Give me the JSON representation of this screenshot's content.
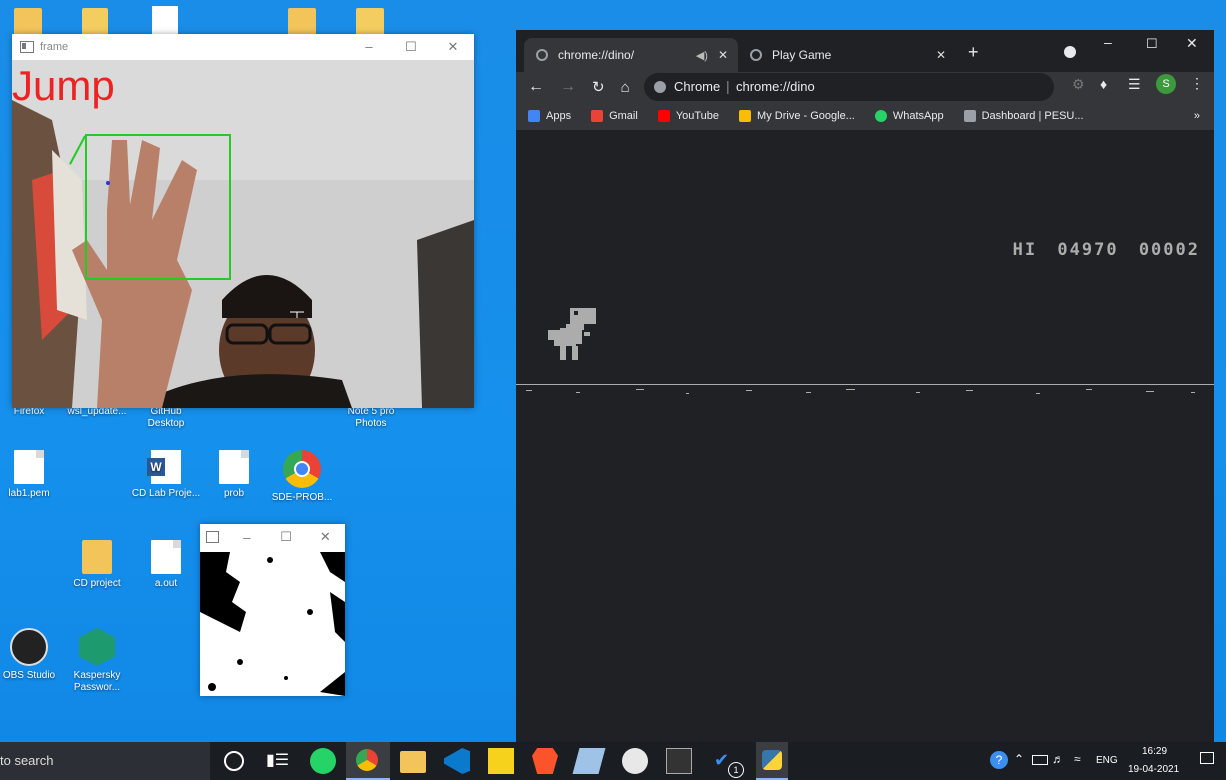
{
  "desktop": {
    "icons": [
      {
        "label": "Firefox",
        "name": "desktop-icon-firefox"
      },
      {
        "label": "wsl_update...",
        "name": "desktop-icon-wsl-update"
      },
      {
        "label": "GitHub Desktop",
        "name": "desktop-icon-github"
      },
      {
        "label": "Note 5 pro Photos",
        "name": "desktop-icon-note5"
      },
      {
        "label": "lab1.pem",
        "name": "desktop-icon-lab1"
      },
      {
        "label": "CD Lab Proje...",
        "name": "desktop-icon-cdlab"
      },
      {
        "label": "prob",
        "name": "desktop-icon-prob"
      },
      {
        "label": "SDE-PROB...",
        "name": "desktop-icon-sde"
      },
      {
        "label": "CD project",
        "name": "desktop-icon-cdproject"
      },
      {
        "label": "a.out",
        "name": "desktop-icon-aout"
      },
      {
        "label": "OBS Studio",
        "name": "desktop-icon-obs"
      },
      {
        "label": "Kaspersky Passwor...",
        "name": "desktop-icon-kaspersky"
      }
    ]
  },
  "frame_window": {
    "title": "frame",
    "overlay_text": "Jump",
    "box_color": "#22cc22",
    "text_color": "#ee2222"
  },
  "chrome": {
    "tabs": [
      {
        "label": "chrome://dino/"
      },
      {
        "label": "Play Game"
      }
    ],
    "omnibox_prefix": "Chrome",
    "omnibox_url": "chrome://dino",
    "bookmarks": [
      {
        "label": "Apps",
        "color": "#4285f4"
      },
      {
        "label": "Gmail",
        "color": "#ea4335"
      },
      {
        "label": "YouTube",
        "color": "#ff0000"
      },
      {
        "label": "My Drive - Google...",
        "color": "#fbbc04"
      },
      {
        "label": "WhatsApp",
        "color": "#25d366"
      },
      {
        "label": "Dashboard | PESU...",
        "color": "#9aa0a6"
      }
    ],
    "profile_initial": "S",
    "game": {
      "hi_label": "HI",
      "hi_score": "04970",
      "score": "00002"
    }
  },
  "taskbar": {
    "search_placeholder": "to search",
    "language": "ENG",
    "time": "16:29",
    "date": "19-04-2021",
    "vscode_badge": "1"
  }
}
